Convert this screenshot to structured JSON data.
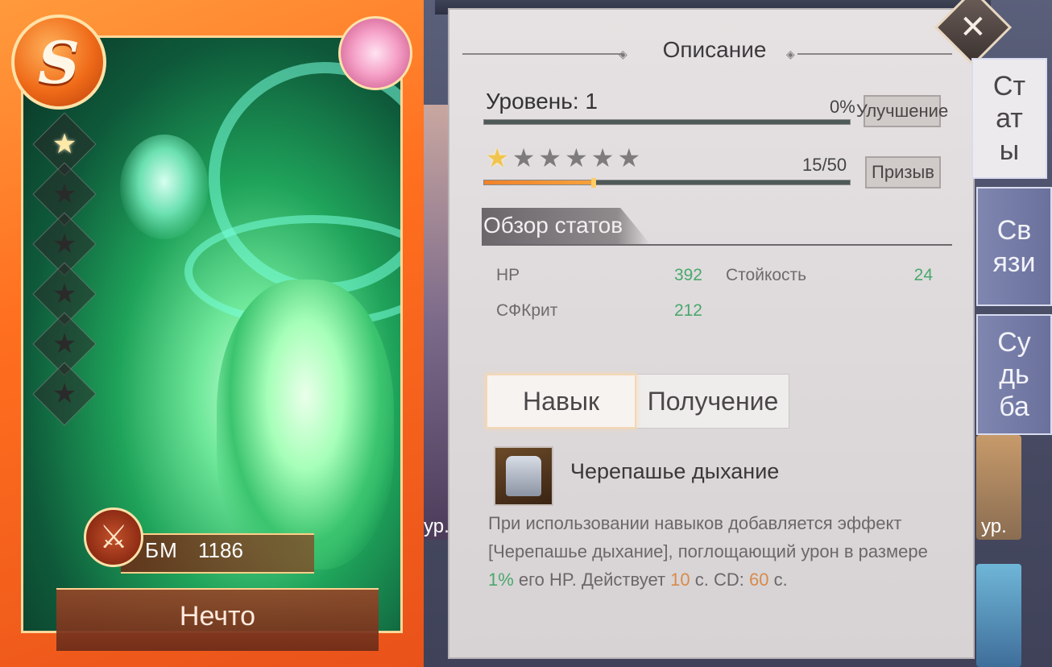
{
  "hero": {
    "rank": "S",
    "name": "Нечто",
    "power_label": "БМ",
    "power_value": "1186",
    "stars_lit": 1,
    "stars_total": 6
  },
  "panel": {
    "title": "Описание",
    "level_label": "Уровень: 1",
    "level_percent": "0%",
    "level_progress": 0,
    "upgrade_button": "Улучшение",
    "stars_lit": 1,
    "stars_total": 6,
    "fragments": "15/50",
    "fragments_progress": 0.3,
    "summon_button": "Призыв",
    "stats_section": "Обзор статов",
    "stats": [
      {
        "name": "HP",
        "value": "392"
      },
      {
        "name": "Стойкость",
        "value": "24"
      },
      {
        "name": "СФКрит",
        "value": "212"
      }
    ],
    "tabs": [
      {
        "label": "Навык",
        "active": true
      },
      {
        "label": "Получение",
        "active": false
      }
    ],
    "skill": {
      "name": "Черепашье дыхание",
      "desc_part1": "При использовании навыков добавляется эффект [Черепашье дыхание], поглощающий урон в размере ",
      "pct": "1%",
      "desc_part2": " его HP. Действует ",
      "duration": "10",
      "desc_part3": " с. CD: ",
      "cooldown": "60",
      "desc_part4": " с."
    }
  },
  "side_tabs": [
    {
      "lines": [
        "Ст",
        "ат",
        "ы"
      ],
      "active": true
    },
    {
      "lines": [
        "Св",
        "язи"
      ],
      "active": false
    },
    {
      "lines": [
        "Су",
        "дь",
        "ба"
      ],
      "active": false
    }
  ],
  "background": {
    "peek_label_left": "ур.",
    "peek_label_right": "ур."
  },
  "colors": {
    "accent_orange": "#f0822a",
    "stat_green": "#4aa86c",
    "highlight_orange": "#d88a4a",
    "side_tab_blue": "#7f86b0"
  },
  "icons": {
    "close": "close-icon",
    "power": "crossed-swords-icon",
    "skill": "armor-icon",
    "star": "star-icon"
  }
}
